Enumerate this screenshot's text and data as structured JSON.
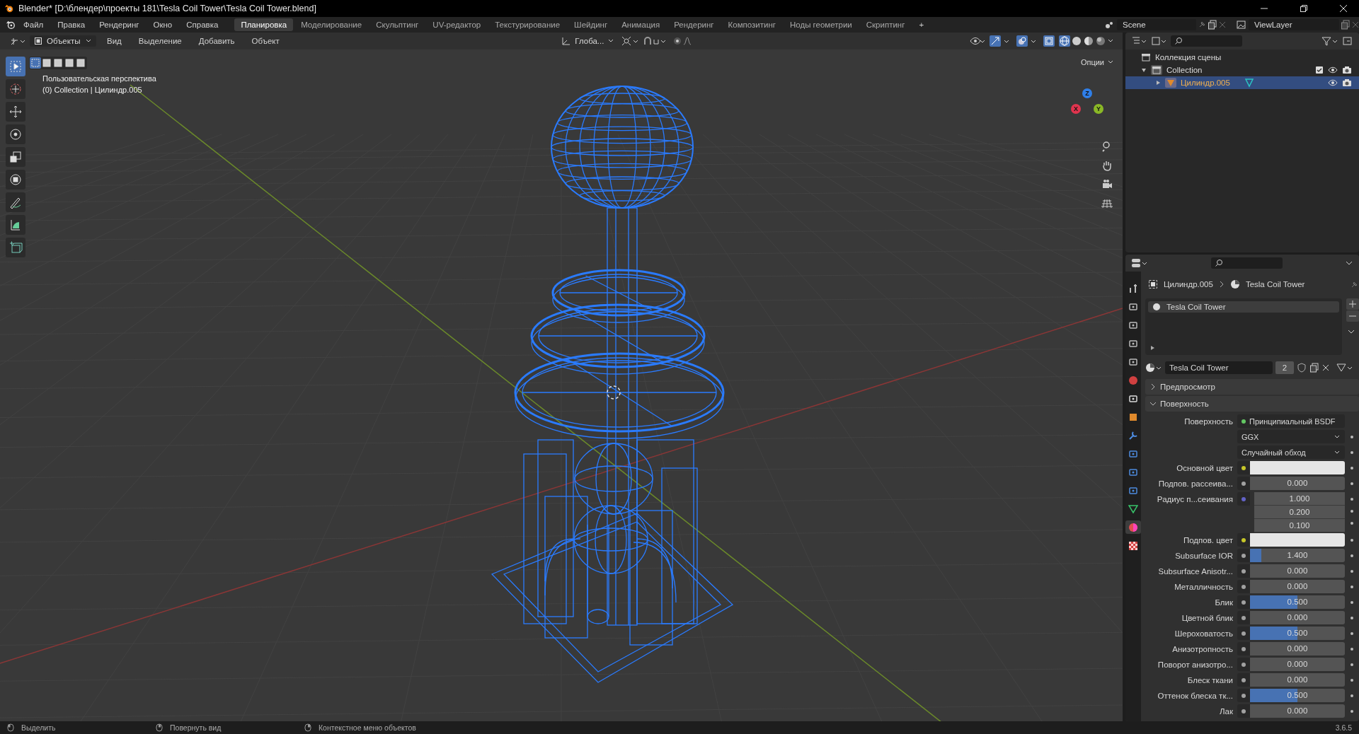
{
  "window": {
    "title": "Blender* [D:\\блендер\\проекты 181\\Tesla Coil Tower\\Tesla Coil Tower.blend]"
  },
  "menu": [
    "Файл",
    "Правка",
    "Рендеринг",
    "Окно",
    "Справка"
  ],
  "workspaces": [
    {
      "label": "Планировка",
      "selected": true
    },
    {
      "label": "Моделирование",
      "selected": false
    },
    {
      "label": "Скульптинг",
      "selected": false
    },
    {
      "label": "UV-редактор",
      "selected": false
    },
    {
      "label": "Текстурирование",
      "selected": false
    },
    {
      "label": "Шейдинг",
      "selected": false
    },
    {
      "label": "Анимация",
      "selected": false
    },
    {
      "label": "Рендеринг",
      "selected": false
    },
    {
      "label": "Композитинг",
      "selected": false
    },
    {
      "label": "Ноды геометрии",
      "selected": false
    },
    {
      "label": "Скриптинг",
      "selected": false
    }
  ],
  "add_workspace": "+",
  "scene": "Scene",
  "view_layer": "ViewLayer",
  "viewport_header": {
    "mode": "Объекты",
    "menus": [
      "Вид",
      "Выделение",
      "Добавить",
      "Объект"
    ],
    "orientation": "Глоба...",
    "options": "Опции"
  },
  "select_modes": [
    {
      "selected": true
    },
    {
      "selected": false
    },
    {
      "selected": false
    },
    {
      "selected": false
    },
    {
      "selected": false
    }
  ],
  "viewport": {
    "view_name": "Пользовательская перспектива",
    "object_info": "(0) Collection | Цилиндр.005",
    "axes": [
      {
        "label": "Z",
        "color": "#2f7fe8"
      },
      {
        "label": "X",
        "color": "#e0344e"
      },
      {
        "label": "Y",
        "color": "#8ab826"
      }
    ]
  },
  "tools": [
    {
      "kind": "select",
      "selected": true
    },
    {
      "kind": "cursor",
      "selected": false
    },
    {
      "kind": "move",
      "selected": false
    },
    {
      "kind": "rotate",
      "selected": false
    },
    {
      "kind": "scale",
      "selected": false
    },
    {
      "kind": "transform",
      "selected": false
    },
    {
      "kind": "annotate",
      "selected": false
    },
    {
      "kind": "measure",
      "selected": false
    },
    {
      "kind": "add-cube",
      "selected": false
    }
  ],
  "outliner": {
    "tree": [
      {
        "label": "Коллекция сцены",
        "kind": "scene-collection",
        "selected": false,
        "children": [
          {
            "label": "Collection",
            "kind": "collection",
            "selected": false,
            "expanded": true,
            "children": [
              {
                "label": "Цилиндр.005",
                "kind": "mesh",
                "selected": true,
                "expanded": false
              }
            ]
          }
        ]
      }
    ]
  },
  "properties": {
    "tabs": [
      {
        "kind": "tool",
        "selected": false
      },
      {
        "kind": "render",
        "selected": false
      },
      {
        "kind": "output",
        "selected": false
      },
      {
        "kind": "view-layer",
        "selected": false
      },
      {
        "kind": "scene",
        "selected": false
      },
      {
        "kind": "world",
        "selected": false
      },
      {
        "kind": "collection",
        "selected": false
      },
      {
        "kind": "object",
        "selected": false
      },
      {
        "kind": "modifier",
        "selected": false
      },
      {
        "kind": "particles",
        "selected": false
      },
      {
        "kind": "physics",
        "selected": false
      },
      {
        "kind": "constraint",
        "selected": false
      },
      {
        "kind": "data",
        "selected": false
      },
      {
        "kind": "material",
        "selected": true
      },
      {
        "kind": "texture",
        "selected": false
      }
    ],
    "breadcrumb": [
      "Цилиндр.005",
      "Tesla Coil Tower"
    ],
    "slots": [
      {
        "label": "Tesla Coil Tower",
        "selected": true
      }
    ],
    "material": {
      "name": "Tesla Coil Tower",
      "users": "2"
    },
    "panels": [
      {
        "label": "Предпросмотр",
        "expanded": false
      },
      {
        "label": "Поверхность",
        "expanded": true
      }
    ],
    "rows": [
      {
        "kind": "shader",
        "label": "Поверхность",
        "value": "Принципиальный BSDF",
        "color": "#63c763"
      },
      {
        "kind": "dropdown",
        "value": "GGX"
      },
      {
        "kind": "dropdown",
        "value": "Случайный обход"
      },
      {
        "kind": "color",
        "label": "Основной цвет",
        "color": "#c7c729"
      },
      {
        "kind": "number",
        "label": "Подпов. рассеива...",
        "value": "0.000",
        "level": 0,
        "color": "#a1a1a1"
      },
      {
        "kind": "vector",
        "label": "Радиус п...сеивания",
        "values": [
          "1.000",
          "0.200",
          "0.100"
        ],
        "color": "#6363c7"
      },
      {
        "kind": "color",
        "label": "Подпов. цвет",
        "color": "#c7c729"
      },
      {
        "kind": "number",
        "label": "Subsurface IOR",
        "value": "1.400",
        "level": 0.12,
        "color": "#a1a1a1"
      },
      {
        "kind": "number",
        "label": "Subsurface Anisotr...",
        "value": "0.000",
        "level": 0,
        "color": "#a1a1a1"
      },
      {
        "kind": "number",
        "label": "Металличность",
        "value": "0.000",
        "level": 0,
        "color": "#a1a1a1"
      },
      {
        "kind": "number",
        "label": "Блик",
        "value": "0.500",
        "level": 0.5,
        "color": "#a1a1a1"
      },
      {
        "kind": "number",
        "label": "Цветной блик",
        "value": "0.000",
        "level": 0,
        "color": "#a1a1a1"
      },
      {
        "kind": "number",
        "label": "Шероховатость",
        "value": "0.500",
        "level": 0.5,
        "color": "#a1a1a1"
      },
      {
        "kind": "number",
        "label": "Анизотропность",
        "value": "0.000",
        "level": 0,
        "color": "#a1a1a1"
      },
      {
        "kind": "number",
        "label": "Поворот анизотро...",
        "value": "0.000",
        "level": 0,
        "color": "#a1a1a1"
      },
      {
        "kind": "number",
        "label": "Блеск ткани",
        "value": "0.000",
        "level": 0,
        "color": "#a1a1a1"
      },
      {
        "kind": "number",
        "label": "Оттенок блеска тк...",
        "value": "0.500",
        "level": 0.5,
        "color": "#a1a1a1"
      },
      {
        "kind": "number",
        "label": "Лак",
        "value": "0.000",
        "level": 0,
        "color": "#a1a1a1"
      }
    ]
  },
  "status_bar": {
    "hints": [
      "Выделить",
      "Повернуть вид",
      "Контекстное меню объектов"
    ],
    "version": "3.6.5"
  }
}
